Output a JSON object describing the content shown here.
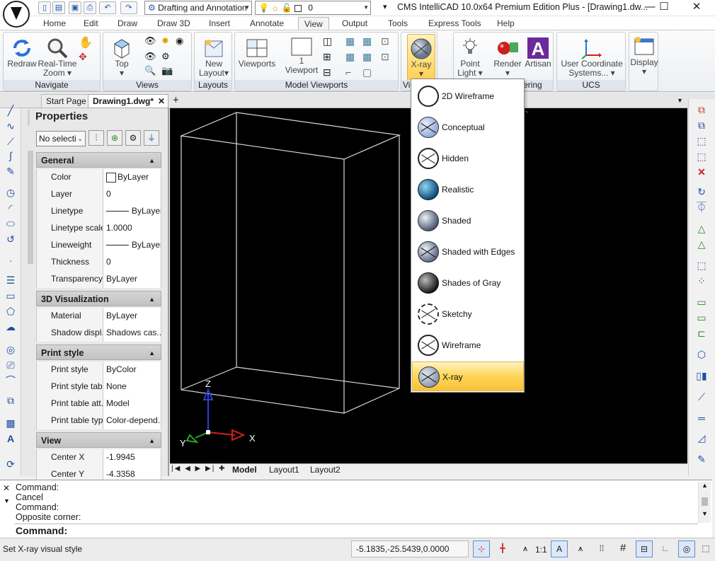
{
  "titlebar": {
    "title": "CMS IntelliCAD 10.0x64 Premium Edition Plus - [Drawing1.dw...",
    "workspace": "Drafting and Annotation",
    "layer_value": "0",
    "minimize": "—",
    "maximize": "☐",
    "close": "✕"
  },
  "menu_tabs": [
    "Home",
    "Edit",
    "Draw",
    "Draw 3D",
    "Insert",
    "Annotate",
    "View",
    "Output",
    "Tools",
    "Express Tools",
    "Help"
  ],
  "ribbon": {
    "navigate": {
      "label": "Navigate",
      "redraw": "Redraw",
      "realtime_zoom_1": "Real-Time",
      "realtime_zoom_2": "Zoom"
    },
    "views": {
      "label": "Views",
      "top": "Top"
    },
    "layouts": {
      "label": "Layouts",
      "new_layout_1": "New",
      "new_layout_2": "Layout"
    },
    "model_viewports": {
      "label": "Model Viewports",
      "viewports": "Viewports",
      "one_viewport_1": "1",
      "one_viewport_2": "Viewport"
    },
    "visual": {
      "label_cut": "Vi",
      "xray": "X-ray"
    },
    "rendering": {
      "label_cut": "ering",
      "point_light_1": "Point",
      "point_light_2": "Light",
      "render": "Render",
      "artisan": "Artisan"
    },
    "ucs": {
      "label": "UCS",
      "user_coord_1": "User Coordinate",
      "user_coord_2": "Systems..."
    },
    "display": {
      "label": "Display"
    }
  },
  "doc_tabs": {
    "start": "Start Page",
    "drawing": "Drawing1.dwg*",
    "close": "✕",
    "add": "+"
  },
  "properties": {
    "title": "Properties",
    "selection": "No selecti",
    "sections": [
      {
        "name": "General",
        "rows": [
          [
            "Color",
            "ByLayer"
          ],
          [
            "Layer",
            "0"
          ],
          [
            "Linetype",
            "ByLayer"
          ],
          [
            "Linetype scale",
            "1.0000"
          ],
          [
            "Lineweight",
            "ByLayer"
          ],
          [
            "Thickness",
            "0"
          ],
          [
            "Transparency",
            "ByLayer"
          ]
        ]
      },
      {
        "name": "3D Visualization",
        "rows": [
          [
            "Material",
            "ByLayer"
          ],
          [
            "Shadow displ...",
            "Shadows cas..."
          ]
        ]
      },
      {
        "name": "Print style",
        "rows": [
          [
            "Print style",
            "ByColor"
          ],
          [
            "Print style table",
            "None"
          ],
          [
            "Print table att...",
            "Model"
          ],
          [
            "Print table type",
            "Color-depend..."
          ]
        ]
      },
      {
        "name": "View",
        "rows": [
          [
            "Center X",
            "-1.9945"
          ],
          [
            "Center Y",
            "-4.3358"
          ]
        ]
      }
    ]
  },
  "canvas": {
    "axis_x": "X",
    "axis_y": "Y",
    "axis_z": "Z"
  },
  "layout_tabs": {
    "model": "Model",
    "layout1": "Layout1",
    "layout2": "Layout2"
  },
  "visual_style_menu": {
    "items": [
      {
        "label": "2D Wireframe",
        "icon": "2d-wireframe-icon"
      },
      {
        "label": "Conceptual",
        "icon": "conceptual-icon"
      },
      {
        "label": "Hidden",
        "icon": "hidden-icon"
      },
      {
        "label": "Realistic",
        "icon": "realistic-icon"
      },
      {
        "label": "Shaded",
        "icon": "shaded-icon"
      },
      {
        "label": "Shaded with Edges",
        "icon": "shaded-edges-icon"
      },
      {
        "label": "Shades of Gray",
        "icon": "shades-of-gray-icon"
      },
      {
        "label": "Sketchy",
        "icon": "sketchy-icon"
      },
      {
        "label": "Wireframe",
        "icon": "wireframe-icon"
      },
      {
        "label": "X-ray",
        "icon": "xray-icon"
      }
    ],
    "selected": "X-ray"
  },
  "command": {
    "history": [
      "Command:",
      "Cancel",
      "Command:",
      "Opposite corner:"
    ],
    "prompt": "Command:"
  },
  "status": {
    "message": "Set X-ray visual style",
    "coords": "-5.1835,-25.5439,0.0000",
    "scale": "1:1"
  }
}
